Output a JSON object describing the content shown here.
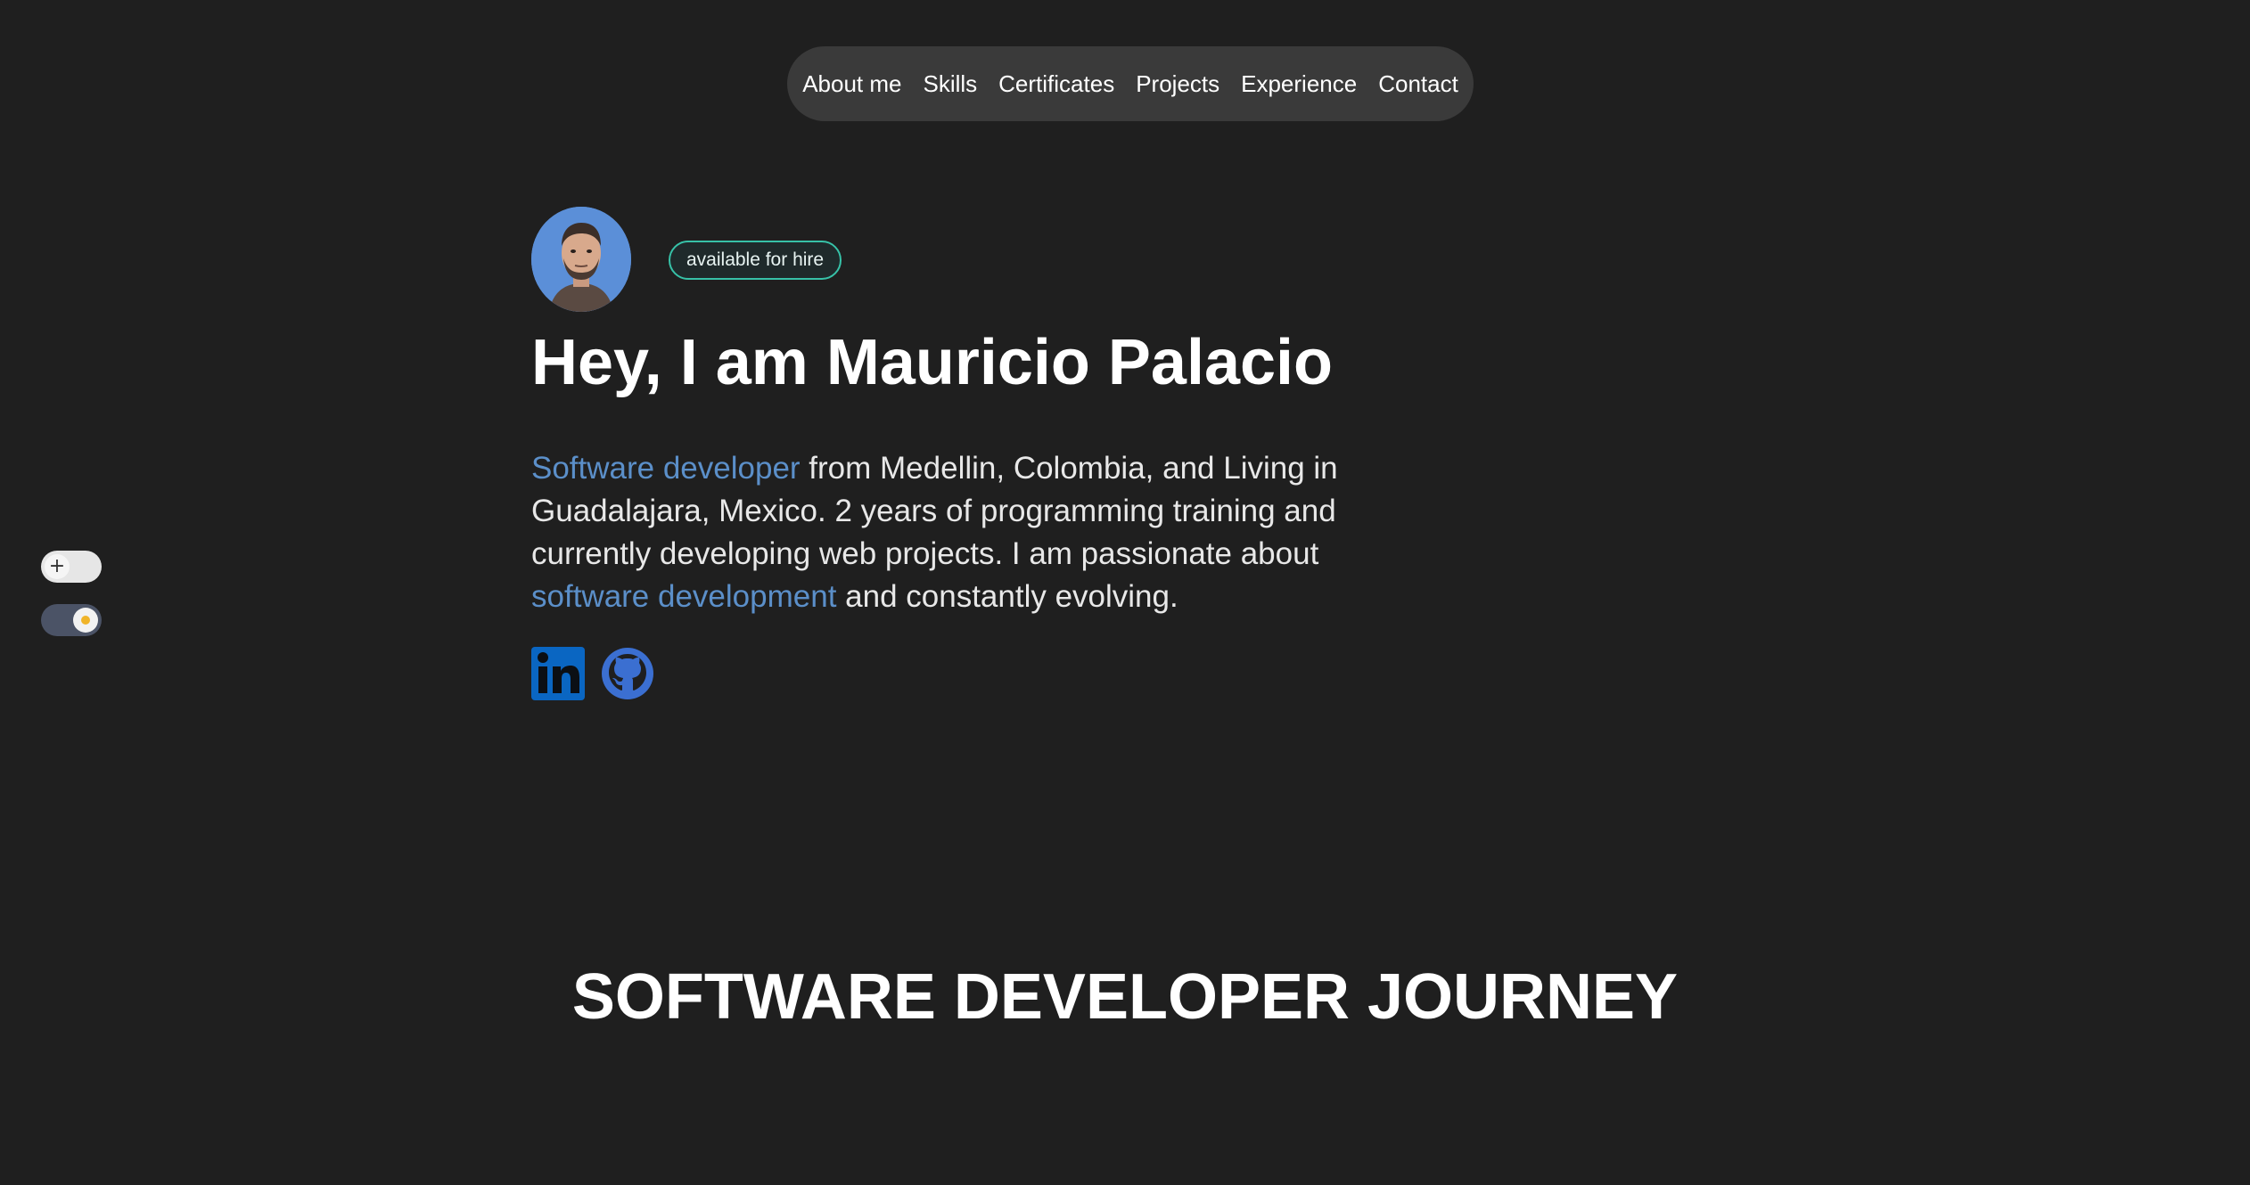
{
  "nav": {
    "items": [
      {
        "label": "About me"
      },
      {
        "label": "Skills"
      },
      {
        "label": "Certificates"
      },
      {
        "label": "Projects"
      },
      {
        "label": "Experience"
      },
      {
        "label": "Contact"
      }
    ]
  },
  "toggles": {
    "first_icon": "plus-icon",
    "second_icon": "sun-icon"
  },
  "hero": {
    "badge": "available for hire",
    "title": "Hey, I am Mauricio Palacio",
    "intro_highlight_1": "Software developer",
    "intro_text_1": " from Medellin, Colombia, and Living in Guadalajara, Mexico. 2 years of programming training and currently developing web projects. I am passionate about ",
    "intro_highlight_2": "software development",
    "intro_text_2": " and constantly evolving."
  },
  "social": {
    "icons": [
      "linkedin-icon",
      "github-icon"
    ]
  },
  "section": {
    "journey_title": "SOFTWARE DEVELOPER JOURNEY"
  },
  "colors": {
    "background": "#1f1f1f",
    "nav_background": "#3a3a3a",
    "link_highlight": "#5b8fc9",
    "badge_border": "#37c2a8",
    "linkedin": "#0a66c2",
    "github": "#3b6fd1"
  }
}
